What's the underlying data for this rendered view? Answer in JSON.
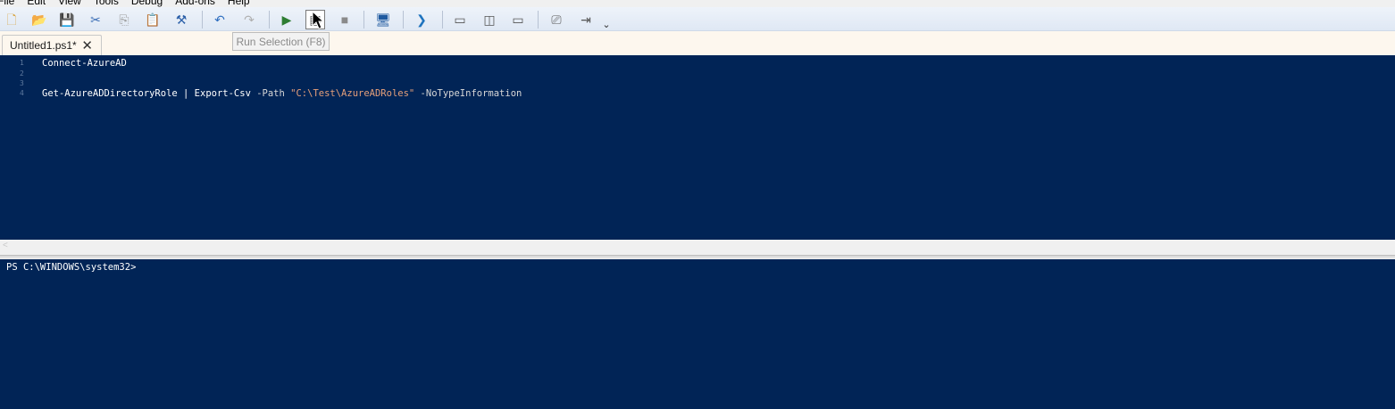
{
  "menu": [
    "File",
    "Edit",
    "View",
    "Tools",
    "Debug",
    "Add-ons",
    "Help"
  ],
  "toolbar": {
    "tooltip": "Run Selection (F8)",
    "buttons": [
      {
        "name": "new-script-icon",
        "glyph": "🗋"
      },
      {
        "name": "open-folder-icon",
        "glyph": "📂"
      },
      {
        "name": "save-icon",
        "glyph": "💾"
      },
      {
        "name": "cut-icon",
        "glyph": "✂"
      },
      {
        "name": "copy-icon",
        "glyph": "⎘"
      },
      {
        "name": "paste-icon",
        "glyph": "📋"
      },
      {
        "name": "clear-console-icon",
        "glyph": "⚒"
      },
      {
        "name": "undo-icon",
        "glyph": "↶"
      },
      {
        "name": "redo-icon",
        "glyph": "↷"
      },
      {
        "name": "run-script-icon",
        "glyph": "▶"
      },
      {
        "name": "run-selection-icon",
        "glyph": "▤"
      },
      {
        "name": "stop-icon",
        "glyph": "■"
      },
      {
        "name": "remote-powershell-icon",
        "glyph": "🖥"
      },
      {
        "name": "start-powershell-icon",
        "glyph": "❯"
      },
      {
        "name": "show-script-top-icon",
        "glyph": "▭"
      },
      {
        "name": "show-script-right-icon",
        "glyph": "◫"
      },
      {
        "name": "show-script-maximized-icon",
        "glyph": "▭"
      },
      {
        "name": "show-script-pane-icon",
        "glyph": "⎚"
      },
      {
        "name": "show-commands-addon-icon",
        "glyph": "⇥"
      },
      {
        "name": "toolbar-overflow-icon",
        "glyph": "⌄"
      }
    ]
  },
  "tab": {
    "title": "Untitled1.ps1*",
    "close": "✕"
  },
  "editor": {
    "lines": [
      {
        "num": "1",
        "tokens": [
          {
            "t": "Connect-AzureAD",
            "c": "code"
          }
        ]
      },
      {
        "num": "2",
        "tokens": []
      },
      {
        "num": "3",
        "tokens": []
      },
      {
        "num": "4",
        "tokens": [
          {
            "t": "Get-AzureADDirectoryRole | Export-Csv ",
            "c": "code"
          },
          {
            "t": "-Path ",
            "c": "param"
          },
          {
            "t": "\"C:\\Test\\AzureADRoles\"",
            "c": "str"
          },
          {
            "t": " -NoTypeInformation",
            "c": "param"
          }
        ]
      }
    ]
  },
  "console": {
    "prompt": "PS C:\\WINDOWS\\system32>"
  }
}
